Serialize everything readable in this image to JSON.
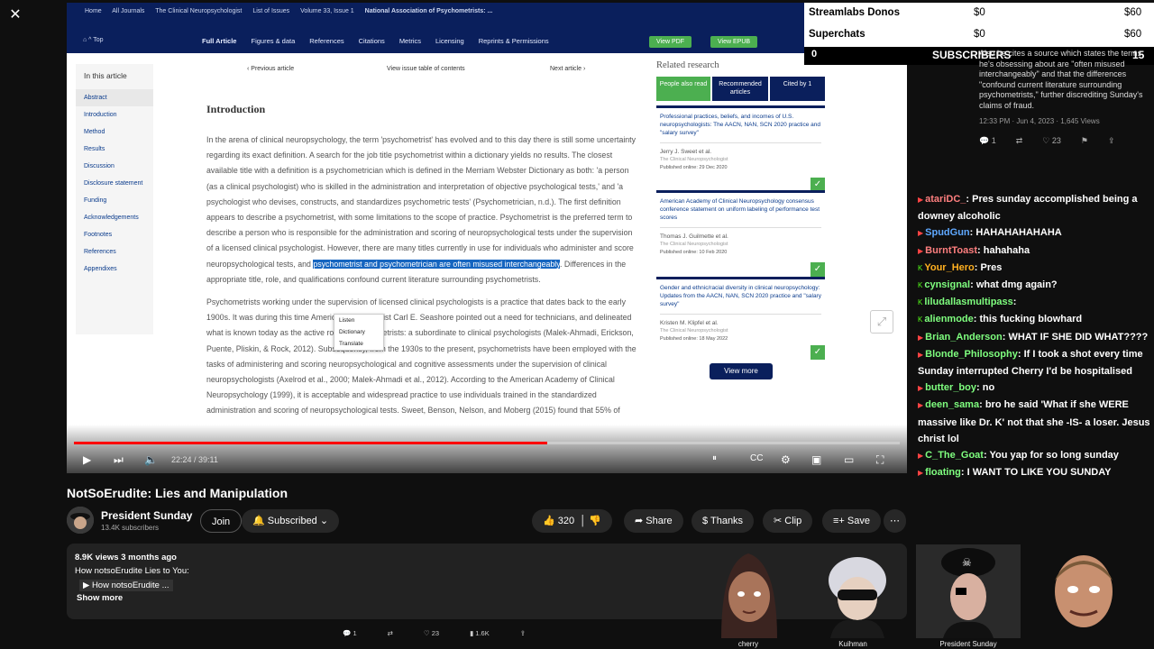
{
  "close_glyph": "✕",
  "video": {
    "breadcrumbs": [
      "Home",
      "All Journals",
      "The Clinical Neuropsychologist",
      "List of Issues",
      "Volume 33, Issue 1",
      "National Association of Psychometrists: ..."
    ],
    "top_label": "Top",
    "nav": [
      "Full Article",
      "Figures & data",
      "References",
      "Citations",
      "Metrics",
      "Licensing",
      "Reprints & Permissions"
    ],
    "view_pdf": "View PDF",
    "view_epub": "View EPUB",
    "in_this_article": "In this article",
    "left_nav": [
      "Abstract",
      "Introduction",
      "Method",
      "Results",
      "Discussion",
      "Disclosure statement",
      "Funding",
      "Acknowledgements",
      "Footnotes",
      "References",
      "Appendixes"
    ],
    "prev_article": "Previous article",
    "view_issue": "View issue table of contents",
    "next_article": "Next article",
    "section_title": "Introduction",
    "para1_a": "In the arena of clinical neuropsychology, the term 'psychometrist' has evolved and to this day there is still some uncertainty regarding its exact definition. A search for the job title psychometrist within a dictionary yields no results. The closest available title with a definition is a psychometrician which is defined in the Merriam Webster Dictionary as both: 'a person (as a clinical psychologist) who is skilled in the administration and interpretation of objective psychological tests,' and 'a psychologist who devises, constructs, and standardizes psychometric tests' (Psychometrician, n.d.). The first definition appears to describe a psychometrist, with some limitations to the scope of practice. Psychometrist is the preferred term to describe a person who is responsible for the administration and scoring of neuropsychological tests under the supervision of a licensed clinical psychologist. However, there are many titles currently in use for individuals who administer and score neuropsychological tests, and ",
    "para1_hl": "psychometrist and psychometrician are often misused interchangeably",
    "para1_b": ". Differences in the appropriate title, role, and qualifications confound current literature surrounding psychometrists.",
    "para2": "Psychometrists working under the supervision of licensed clinical psychologists is a practice that dates back to the early 1900s. It was during this time American Psychologist Carl E. Seashore pointed out a need for technicians, and delineated what is known today as the active role of psychometrists: a subordinate to clinical psychologists (Malek-Ahmadi, Erickson, Puente, Pliskin, & Rock, 2012). Subsequently, from the 1930s to the present, psychometrists have been employed with the tasks of administering and scoring neuropsychological and cognitive assessments under the supervision of clinical neuropsychologists (Axelrod et al., 2000; Malek-Ahmadi et al., 2012). According to the American Academy of Clinical Neuropsychology (1999), it is acceptable and widespread practice to use individuals trained in the standardized administration and scoring of neuropsychological tests. Sweet, Benson, Nelson, and Moberg (2015) found that 55% of",
    "context_menu": [
      "Listen",
      "Dictionary",
      "Translate"
    ],
    "related_title": "Related research",
    "related_tabs": [
      "People also read",
      "Recommended articles",
      "Cited by 1"
    ],
    "related": [
      {
        "title": "Professional practices, beliefs, and incomes of U.S. neuropsychologists: The AACN, NAN, SCN 2020 practice and \"salary survey\"",
        "authors": "Jerry J. Sweet et al.",
        "journal": "The Clinical Neuropsychologist",
        "published": "Published online: 29 Dec 2020"
      },
      {
        "title": "American Academy of Clinical Neuropsychology consensus conference statement on uniform labeling of performance test scores",
        "authors": "Thomas J. Guilmette et al.",
        "journal": "The Clinical Neuropsychologist",
        "published": "Published online: 10 Feb 2020"
      },
      {
        "title": "Gender and ethnic/racial diversity in clinical neuropsychology: Updates from the AACN, NAN, SCN 2020 practice and \"salary survey\"",
        "authors": "Kristen M. Klipfel et al.",
        "journal": "The Clinical Neuropsychologist",
        "published": "Published online: 18 May 2022"
      }
    ],
    "view_more": "View more",
    "time": "22:24 / 39:11",
    "progress": 0.573
  },
  "meta": {
    "title": "NotSoErudite: Lies and Manipulation",
    "channel": "President Sunday",
    "subscribers": "13.4K subscribers",
    "join": "Join",
    "subscribed": "Subscribed",
    "likes": "320",
    "share": "Share",
    "thanks": "Thanks",
    "clip": "Clip",
    "save": "Save",
    "views": "8.9K views  3 months ago",
    "desc_line": "How notsoErudite Lies to You:",
    "desc_link": "▶ How notsoErudite ...",
    "show_more": "Show more",
    "tweet_bar": [
      "1",
      "",
      "23",
      "1.6K",
      ""
    ]
  },
  "overlay": {
    "streamlabs_label": "Streamlabs Donos",
    "streamlabs_amt": "$0",
    "streamlabs_goal": "$60",
    "superchats_label": "Superchats",
    "superchats_amt": "$0",
    "superchats_goal": "$60",
    "sub_left": "0",
    "subscribers_label": "SUBSCRIBERS",
    "sub_right": "15"
  },
  "tweet": {
    "text": "Also he cites a source which states the terms he's obsessing about are \"often misused interchangeably\" and that the differences \"confound current literature surrounding psychometrists,\" further discrediting Sunday's claims of fraud.",
    "time": "12:33 PM · Jun 4, 2023 · 1,645 Views",
    "actions": [
      "1",
      "",
      "23",
      "",
      ""
    ]
  },
  "chat": [
    {
      "name": "atariDC_",
      "color": "#ff7f7f",
      "text": ": Pres sunday accomplished being a downey alcoholic"
    },
    {
      "name": "SpudGun",
      "color": "#5fa8ff",
      "text": ": HAHAHAHAHAHA"
    },
    {
      "name": "BurntToast",
      "color": "#ff7f7f",
      "text": ": hahahaha"
    },
    {
      "name": "Your_Hero",
      "color": "#ffb020",
      "text": ": Pres"
    },
    {
      "name": "cynsignal",
      "color": "#7fff7f",
      "text": ": what dmg again?"
    },
    {
      "name": "liludallasmultipass",
      "color": "#7fff7f",
      "text": ":"
    },
    {
      "name": "alienmode",
      "color": "#7fff7f",
      "text": ": this fucking blowhard"
    },
    {
      "name": "Brian_Anderson",
      "color": "#7fff7f",
      "text": ": WHAT IF SHE DID WHAT????"
    },
    {
      "name": "Blonde_Philosophy",
      "color": "#7fff7f",
      "text": ": If I took a shot every time Sunday interrupted Cherry I'd be hospitalised"
    },
    {
      "name": "butter_boy",
      "color": "#7fff7f",
      "text": ": no"
    },
    {
      "name": "deen_sama",
      "color": "#7fff7f",
      "text": ": bro he said 'What if she WERE massive like Dr. K' not that she -IS- a loser. Jesus christ lol"
    },
    {
      "name": "C_The_Goat",
      "color": "#7fff7f",
      "text": ": You yap for so long sunday"
    },
    {
      "name": "floating",
      "color": "#7fff7f",
      "text": ": I WANT TO LIKE YOU SUNDAY"
    }
  ],
  "cams": [
    "cherry",
    "Kuihman",
    "President Sunday"
  ]
}
